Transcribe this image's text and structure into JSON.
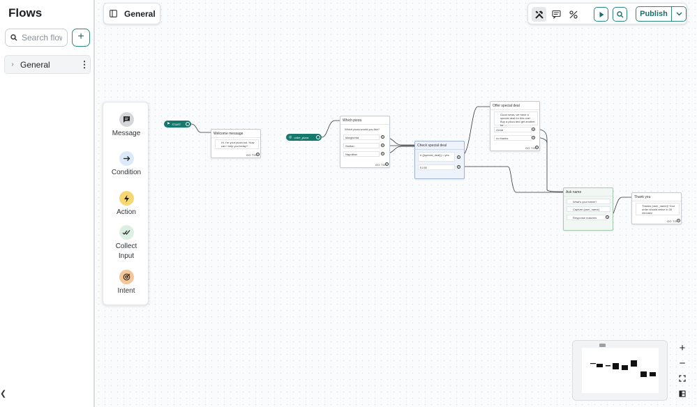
{
  "sidebar": {
    "title": "Flows",
    "search_placeholder": "Search flows",
    "add_label": "+",
    "flows": [
      {
        "label": "General"
      }
    ]
  },
  "header": {
    "flow_title": "General"
  },
  "toolbar": {
    "publish_label": "Publish"
  },
  "palette": [
    {
      "label": "Message",
      "icon": "message-icon"
    },
    {
      "label": "Condition",
      "icon": "arrow-right-icon"
    },
    {
      "label": "Action",
      "icon": "lightning-icon"
    },
    {
      "label": "Collect Input",
      "icon": "double-check-icon"
    },
    {
      "label": "Intent",
      "icon": "target-icon"
    }
  ],
  "canvas": {
    "start_label": "START",
    "order_label": "order_pizza",
    "nodes": {
      "welcome": {
        "title": "Welcome message",
        "text": "Hi, I'm your pizza bot. How can I help you today?",
        "goto": "GO TO"
      },
      "which": {
        "title": "Which pizza",
        "question": "Which pizza would you like?",
        "options": [
          "Margherita",
          "Sicilian",
          "Napolitan"
        ],
        "goto": "GO TO"
      },
      "check": {
        "title": "Check special deal",
        "condition": "# {{special_deal}} = yes",
        "else": "ELSE"
      },
      "offer": {
        "title": "Offer special deal",
        "text": "Good news, we have a special deal for this one! Buy a pizza and get another for ...",
        "options": [
          "Great",
          "no thanks"
        ],
        "goto": "GO TO"
      },
      "ask": {
        "title": "Ask name",
        "question": "What's your name?",
        "capture": "Capture {user_name}",
        "response": "Response matches"
      },
      "thanks": {
        "title": "Thank you",
        "text": "Thanks {user_name}! Your order should arrive in 30 minutes!",
        "goto": "GO TO"
      }
    }
  },
  "zoom": {
    "in": "+",
    "out": "−"
  },
  "colors": {
    "accent": "#17786e",
    "condition_blue": "#dbe9f8",
    "action_yellow": "#f7d774",
    "intent_orange": "#f4c79a",
    "message_gray": "#d4d6d9"
  }
}
